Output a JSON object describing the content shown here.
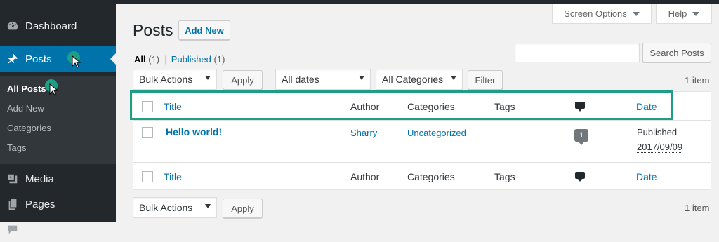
{
  "sidebar": {
    "items": [
      {
        "label": "Dashboard",
        "icon": "dashboard-icon"
      },
      {
        "label": "Posts",
        "icon": "pin-icon"
      },
      {
        "label": "Media",
        "icon": "media-icon"
      },
      {
        "label": "Pages",
        "icon": "pages-icon"
      }
    ],
    "submenu": [
      "All Posts",
      "Add New",
      "Categories",
      "Tags"
    ]
  },
  "header": {
    "title": "Posts",
    "add_new": "Add New",
    "screen_options": "Screen Options",
    "help": "Help"
  },
  "filters": {
    "all_label": "All",
    "all_count": "(1)",
    "separator": "|",
    "published_label": "Published",
    "published_count": "(1)",
    "search_button": "Search Posts",
    "search_value": "",
    "bulk_actions": "Bulk Actions",
    "apply": "Apply",
    "dates": "All dates",
    "categories": "All Categories",
    "filter": "Filter",
    "item_count": "1 item"
  },
  "table": {
    "columns": [
      "Title",
      "Author",
      "Categories",
      "Tags",
      "Date"
    ],
    "rows": [
      {
        "title": "Hello world!",
        "author": "Sharry",
        "categories": "Uncategorized",
        "tags": "—",
        "comments": "1",
        "status": "Published",
        "date": "2017/09/09"
      }
    ]
  },
  "colors": {
    "sidebar_bg": "#23282d",
    "active_menu": "#0073aa",
    "link": "#0073aa",
    "highlight": "#1e9e84"
  }
}
